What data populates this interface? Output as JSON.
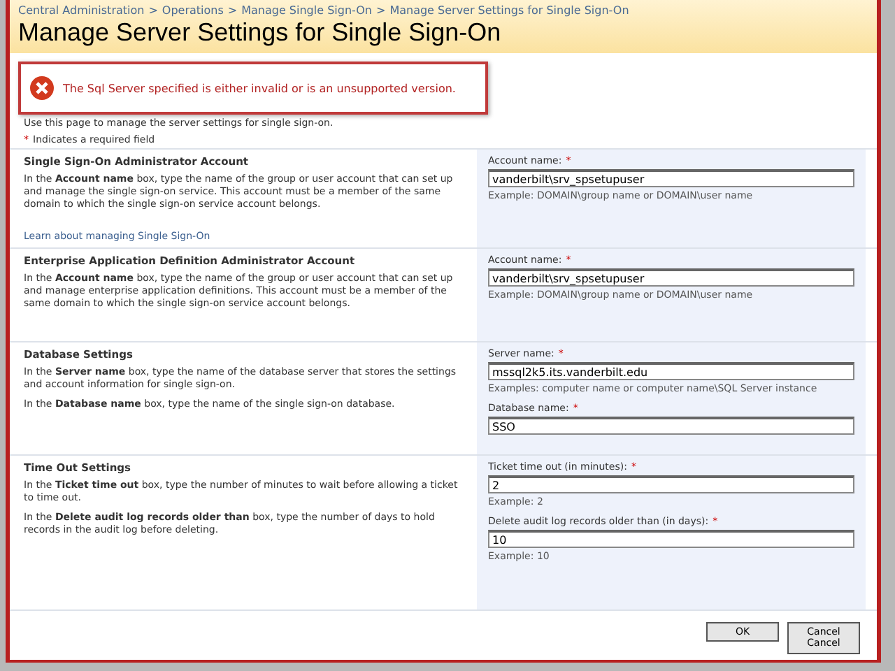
{
  "breadcrumb": [
    "Central Administration",
    "Operations",
    "Manage Single Sign-On",
    "Manage Server Settings for Single Sign-On"
  ],
  "breadcrumb_separator": ">",
  "title": "Manage Server Settings for Single Sign-On",
  "error": {
    "message": "The Sql Server specified is either invalid or is an unsupported version."
  },
  "intro": "Use this page to manage the server settings for single sign-on.",
  "required_note": {
    "mark": "*",
    "text": "Indicates a required field"
  },
  "sections": [
    {
      "heading": "Single Sign-On Administrator Account",
      "paragraphs": [
        "In the **Account name** box, type the name of the group or user account that can set up and manage the single sign-on service. This account must be a member of the same domain to which the single sign-on service account belongs."
      ],
      "link": "Learn about managing Single Sign-On",
      "fields": [
        {
          "label": "Account name:",
          "required": true,
          "value": "vanderbilt\\srv_spsetupuser",
          "example": "Example: DOMAIN\\group name or DOMAIN\\user name"
        }
      ]
    },
    {
      "heading": "Enterprise Application Definition Administrator Account",
      "paragraphs": [
        "In the **Account name** box, type the name of the group or user account that can set up and manage enterprise application definitions. This account must be a member of the same domain to which the single sign-on service account belongs."
      ],
      "fields": [
        {
          "label": "Account name:",
          "required": true,
          "value": "vanderbilt\\srv_spsetupuser",
          "example": "Example: DOMAIN\\group name or DOMAIN\\user name"
        }
      ]
    },
    {
      "heading": "Database Settings",
      "paragraphs": [
        "In the **Server name** box, type the name of the database server that stores the settings and account information for single sign-on.",
        "In the **Database name** box, type the name of the single sign-on database."
      ],
      "fields": [
        {
          "label": "Server name:",
          "required": true,
          "value": "mssql2k5.its.vanderbilt.edu",
          "example": "Examples: computer name or computer name\\SQL Server instance"
        },
        {
          "label": "Database name:",
          "required": true,
          "value": "SSO"
        }
      ]
    },
    {
      "heading": "Time Out Settings",
      "paragraphs": [
        "In the **Ticket time out** box, type the number of minutes to wait before allowing a ticket to time out.",
        "In the **Delete audit log records older than** box, type the number of days to hold records in the audit log before deleting."
      ],
      "fields": [
        {
          "label": "Ticket time out (in minutes):",
          "required": true,
          "value": "2",
          "example": "Example: 2"
        },
        {
          "label": "Delete audit log records older than (in days):",
          "required": true,
          "value": "10",
          "example": "Example: 10"
        }
      ]
    }
  ],
  "buttons": [
    {
      "kind": "ok",
      "labels": [
        "OK"
      ]
    },
    {
      "kind": "cancel",
      "labels": [
        "Cancel",
        "Cancel"
      ]
    }
  ]
}
